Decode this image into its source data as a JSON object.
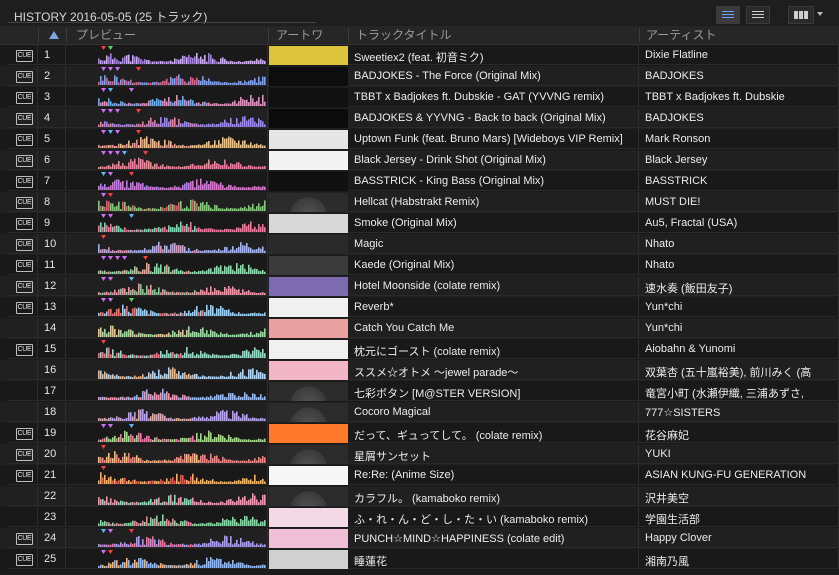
{
  "history_title": "HISTORY 2016-05-05 (25 トラック)",
  "columns": {
    "preview": "プレビュー",
    "artwork": "アートワ",
    "title": "トラックタイトル",
    "artist": "アーティスト"
  },
  "icons": {
    "cue": "CUE",
    "sort": "sort-ascending-icon",
    "list_view": "list-view-icon",
    "detail_view": "detail-view-icon",
    "grid_view": "grid-view-icon"
  },
  "colors": {
    "accent_blue": "#7ea6e0",
    "background": "#1c1c1c"
  },
  "tracks": [
    {
      "num": "1",
      "cue": true,
      "title": "Sweetiex2 (feat. 初音ミク)",
      "artist": "Dixie Flatline",
      "art": "#dcc43c",
      "waveA": "#a67de8",
      "waveB": "#d2a8ff",
      "markers": "r g",
      "pct": 0.72
    },
    {
      "num": "2",
      "cue": true,
      "title": "BADJOKES - The Force (Original Mix)",
      "artist": "BADJOKES",
      "art": "#0d0d0d",
      "waveA": "#e85c8a",
      "waveB": "#7aa0ff",
      "markers": "v v v r",
      "pct": 0.6
    },
    {
      "num": "3",
      "cue": true,
      "title": "TBBT x Badjokes ft. Dubskie - GAT (YVVNG remix)",
      "artist": "TBBT x Badjokes ft. Dubskie",
      "art": "#111",
      "waveA": "#5fb0ff",
      "waveB": "#e88ac0",
      "markers": "v b v",
      "pct": 0.64
    },
    {
      "num": "4",
      "cue": true,
      "title": "BADJOKES & YYVNG - Back to back (Original Mix)",
      "artist": "BADJOKES",
      "art": "#0b0b0b",
      "waveA": "#e87a9c",
      "waveB": "#9b85ff",
      "markers": "v v v r",
      "pct": 0.62
    },
    {
      "num": "5",
      "cue": true,
      "title": "Uptown Funk (feat. Bruno Mars) [Wideboys VIP Remix]",
      "artist": "Mark Ronson",
      "art": "#e6e6e6",
      "waveA": "#f08a8a",
      "waveB": "#f3c07a",
      "markers": "v b v r",
      "pct": 0.58
    },
    {
      "num": "6",
      "cue": true,
      "title": "Black Jersey - Drink Shot (Original Mix)",
      "artist": "Black Jersey",
      "art": "#f3f3f3",
      "waveA": "#ef8e8e",
      "waveB": "#ff6fa0",
      "markers": "v v v b r",
      "pct": 0.7
    },
    {
      "num": "7",
      "cue": true,
      "title": "BASSTRICK - King Bass (Original Mix)",
      "artist": "BASSTRICK",
      "art": "#101010",
      "waveA": "#b77bff",
      "waveB": "#e66dd7",
      "markers": "b v r",
      "pct": 0.66
    },
    {
      "num": "8",
      "cue": true,
      "title": "Hellcat (Habstrakt Remix)",
      "artist": "MUST DIE!",
      "art": "#2b2b2b",
      "waveA": "#e85d6d",
      "waveB": "#7bd06f",
      "markers": "v r",
      "pct": 0.6
    },
    {
      "num": "9",
      "cue": true,
      "title": "Smoke (Original Mix)",
      "artist": "Au5, Fractal (USA)",
      "art": "#d8d8d8",
      "waveA": "#6be0b2",
      "waveB": "#ff6f9c",
      "markers": "v v b",
      "pct": 0.58
    },
    {
      "num": "10",
      "cue": true,
      "title": "Magic",
      "artist": "Nhato",
      "art": "#2a2a2a",
      "waveA": "#f08fb0",
      "waveB": "#9fb3ff",
      "markers": "r",
      "pct": 0.6
    },
    {
      "num": "11",
      "cue": true,
      "title": "Kaede (Original Mix)",
      "artist": "Nhato",
      "art": "#3b3b3b",
      "waveA": "#f0a28f",
      "waveB": "#7fe0a8",
      "markers": "v v v v r",
      "pct": 0.55
    },
    {
      "num": "12",
      "cue": true,
      "title": "Hotel Moonside (colate remix)",
      "artist": "速水奏 (飯田友子)",
      "art": "#7d6bb0",
      "waveA": "#7dd08f",
      "waveB": "#ff8ea5",
      "markers": "v v b",
      "pct": 0.6
    },
    {
      "num": "13",
      "cue": true,
      "title": "Reverb*",
      "artist": "Yun*chi",
      "art": "#f0f0f0",
      "waveA": "#ff6b6b",
      "waveB": "#8fd3ff",
      "markers": "v v g",
      "pct": 0.62
    },
    {
      "num": "14",
      "cue": false,
      "title": "Catch You Catch Me",
      "artist": "Yun*chi",
      "art": "#e8a0a0",
      "waveA": "#e9c48a",
      "waveB": "#8fe09a",
      "markers": "",
      "pct": 0.55
    },
    {
      "num": "15",
      "cue": true,
      "title": "枕元にゴースト (colate remix)",
      "artist": "Aiobahn & Yunomi",
      "art": "#f0f0f0",
      "waveA": "#ff6f86",
      "waveB": "#8be0c8",
      "markers": "r",
      "pct": 0.6
    },
    {
      "num": "16",
      "cue": false,
      "title": "ススメ☆オトメ 〜jewel parade〜",
      "artist": "双葉杏 (五十嵐裕美), 前川みく (高",
      "art": "#f3b6c7",
      "waveA": "#f2b27a",
      "waveB": "#a7d7ff",
      "markers": "",
      "pct": 0.58
    },
    {
      "num": "17",
      "cue": false,
      "title": "七彩ボタン [M@STER VERSION]",
      "artist": "竜宮小町 (水瀬伊織, 三浦あずさ,",
      "art": "#2b2b2b",
      "waveA": "#ff8fb1",
      "waveB": "#8fb9ff",
      "markers": "",
      "pct": 0.55
    },
    {
      "num": "18",
      "cue": false,
      "title": "Cocoro Magical",
      "artist": "777☆SISTERS",
      "art": "#2b2b2b",
      "waveA": "#f3a889",
      "waveB": "#b9a0ff",
      "markers": "",
      "pct": 0.55
    },
    {
      "num": "19",
      "cue": true,
      "title": "だって、ギュってして。 (colate remix)",
      "artist": "花谷麻妃",
      "art": "#ff7a2b",
      "waveA": "#ff6fa8",
      "waveB": "#9fe07f",
      "markers": "v v b",
      "pct": 0.6
    },
    {
      "num": "20",
      "cue": true,
      "title": "星屑サンセット",
      "artist": "YUKI",
      "art": "#2b2b2b",
      "waveA": "#f7bf6a",
      "waveB": "#ff7f7f",
      "markers": "r",
      "pct": 0.6
    },
    {
      "num": "21",
      "cue": true,
      "title": "Re:Re: (Anime Size)",
      "artist": "ASIAN KUNG-FU GENERATION",
      "art": "#f7f7f7",
      "waveA": "#ff4f4f",
      "waveB": "#ffb04f",
      "markers": "r",
      "pct": 0.55
    },
    {
      "num": "22",
      "cue": false,
      "title": "カラフル。 (kamaboko remix)",
      "artist": "沢井美空",
      "art": "#2b2b2b",
      "waveA": "#7fe0b2",
      "waveB": "#ff8fb0",
      "markers": "",
      "pct": 0.55
    },
    {
      "num": "23",
      "cue": false,
      "title": "ふ・れ・ん・ど・し・た・い (kamaboko remix)",
      "artist": "学園生活部",
      "art": "#f3d8e6",
      "waveA": "#ff7b9f",
      "waveB": "#7ae0a0",
      "markers": "",
      "pct": 0.55
    },
    {
      "num": "24",
      "cue": true,
      "title": "PUNCH☆MIND☆HAPPINESS (colate edit)",
      "artist": "Happy Clover",
      "art": "#f0c0d8",
      "waveA": "#ff6b9c",
      "waveB": "#a89bff",
      "markers": "b v r",
      "pct": 0.58
    },
    {
      "num": "25",
      "cue": true,
      "title": "睡蓮花",
      "artist": "湘南乃風",
      "art": "#d0d0d0",
      "waveA": "#ffb36a",
      "waveB": "#86b8ff",
      "markers": "v r",
      "pct": 0.58
    }
  ]
}
